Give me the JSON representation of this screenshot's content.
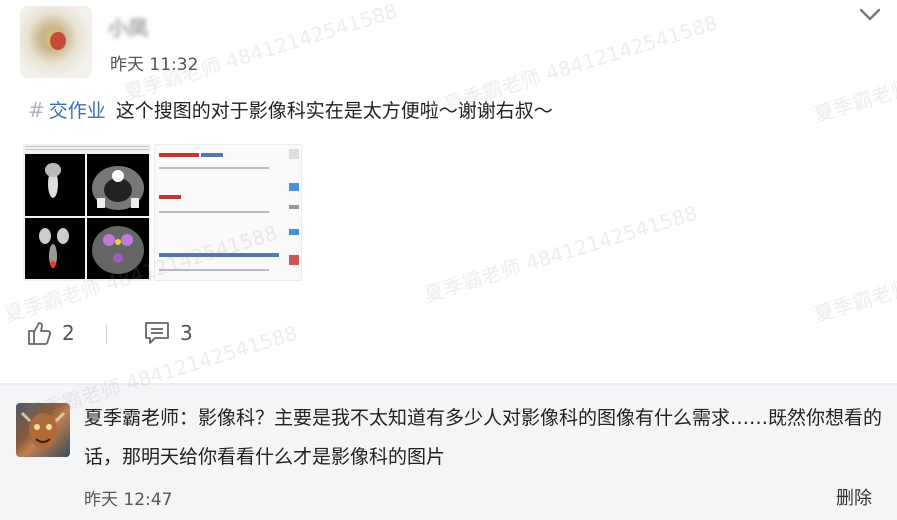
{
  "post": {
    "author_name": "小凤",
    "time": "昨天 11:32",
    "topic_hash": "#",
    "topic": "交作业",
    "text": "这个搜图的对于影像科实在是太方便啦～谢谢右叔～",
    "likes": "2",
    "comments": "3"
  },
  "comment": {
    "text": "夏季霸老师：影像科？主要是我不太知道有多少人对影像科的图像有什么需求……既然你想看的话，那明天给你看看什么才是影像科的图片",
    "time": "昨天 12:47",
    "delete_label": "删除"
  },
  "watermark": {
    "text": "夏季霸老师 48412142541588"
  },
  "colors": {
    "topic": "#3a6db5",
    "comment_bg": "#f4f5f7",
    "icon": "#666666"
  }
}
